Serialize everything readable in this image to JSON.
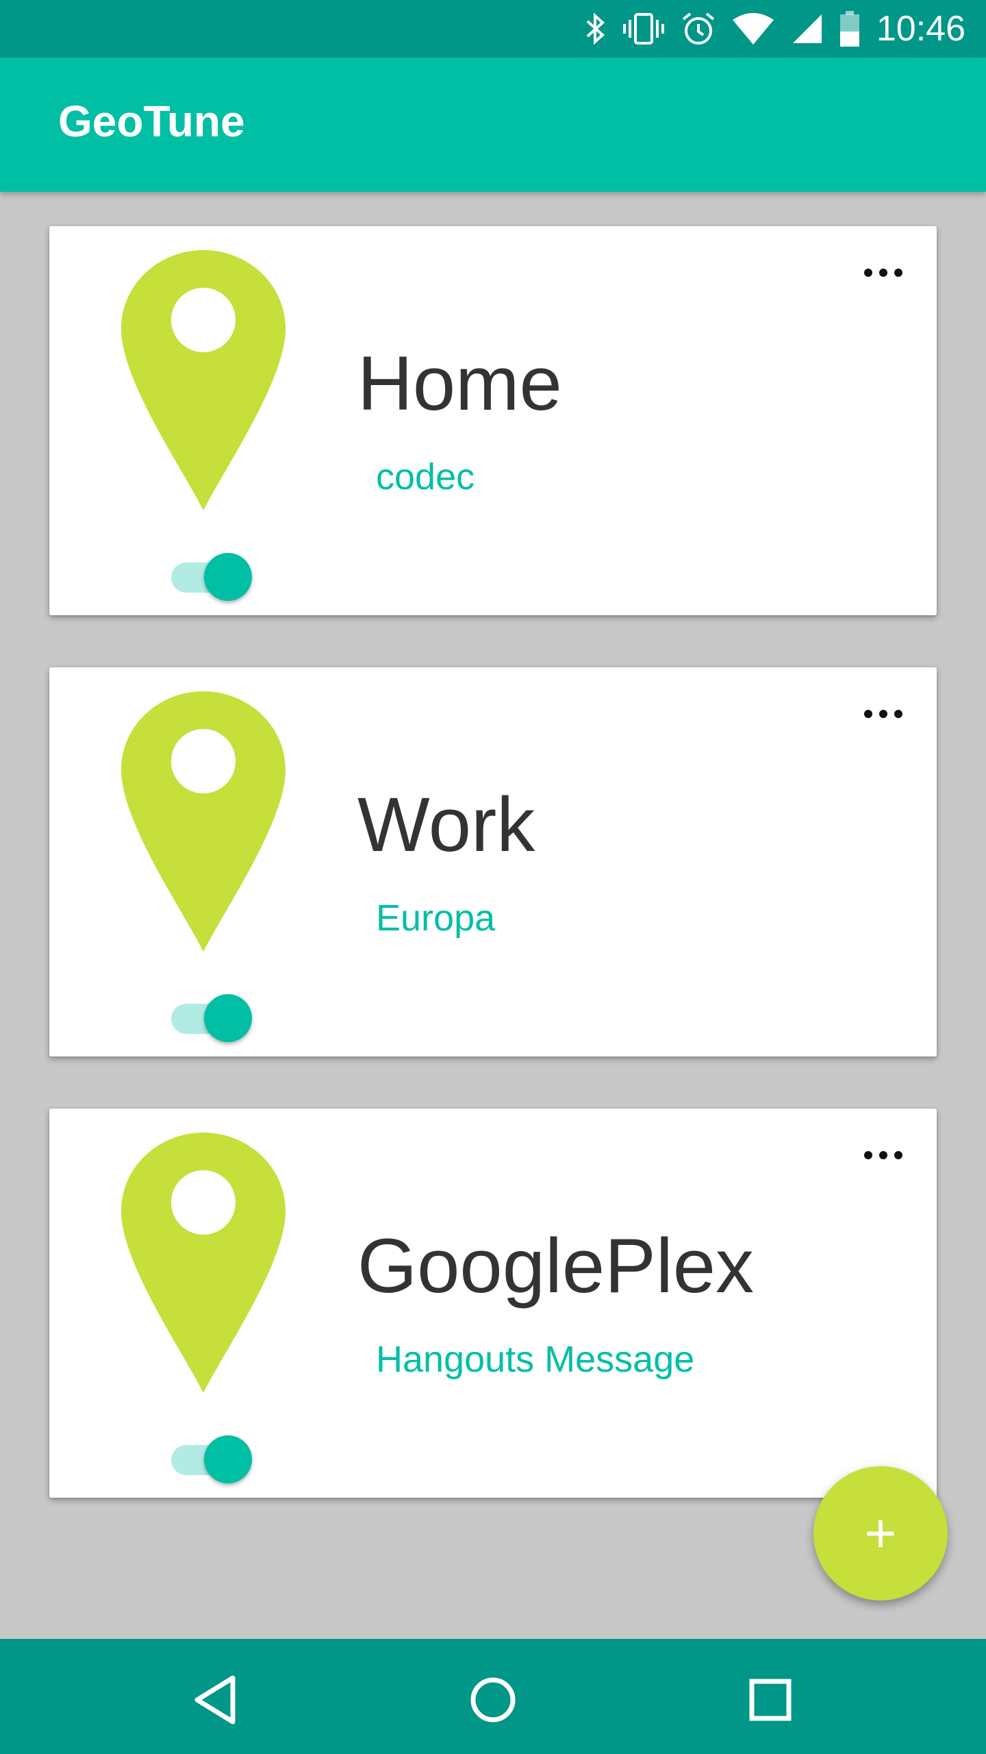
{
  "status_bar": {
    "time": "10:46",
    "icons": [
      "bluetooth-icon",
      "vibrate-icon",
      "alarm-icon",
      "wifi-icon",
      "cell-signal-icon",
      "battery-icon"
    ]
  },
  "app_bar": {
    "title": "GeoTune"
  },
  "cards": [
    {
      "title": "Home",
      "subtitle": "codec",
      "enabled": true,
      "icon": "location-pin-icon"
    },
    {
      "title": "Work",
      "subtitle": "Europa",
      "enabled": true,
      "icon": "location-pin-icon"
    },
    {
      "title": "GooglePlex",
      "subtitle": "Hangouts Message",
      "enabled": true,
      "icon": "location-pin-icon"
    }
  ],
  "fab": {
    "label": "+"
  },
  "nav_bar": {
    "icons": [
      "back-icon",
      "home-icon",
      "recents-icon"
    ]
  },
  "colors": {
    "status_bar": "#009688",
    "app_bar": "#00bfa5",
    "accent": "#00bfa5",
    "pin": "#c6df3a",
    "fab": "#c6df3a",
    "background": "#c8c8c8"
  }
}
